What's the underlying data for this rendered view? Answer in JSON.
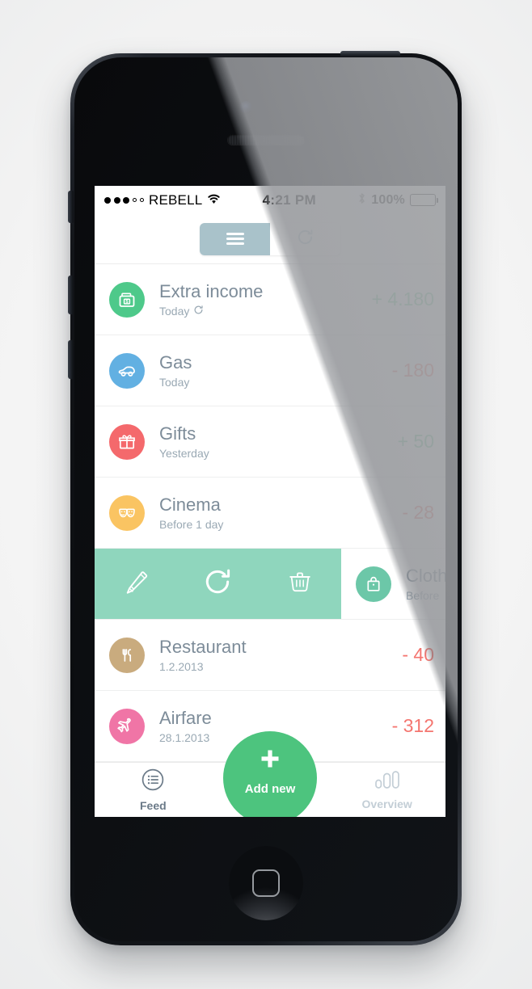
{
  "status_bar": {
    "signal_dots_filled": 3,
    "signal_dots_empty": 2,
    "carrier": "REBELL",
    "time": "4:21 PM",
    "battery_percent": "100%",
    "bluetooth_icon": "bluetooth-icon",
    "wifi_icon": "wifi-icon"
  },
  "header": {
    "segments": [
      {
        "id": "list",
        "icon": "hamburger-icon",
        "active": true
      },
      {
        "id": "repeat",
        "icon": "refresh-icon",
        "active": false
      }
    ]
  },
  "colors": {
    "positive": "#79d3a1",
    "negative": "#f4756f",
    "accent_green": "#4dc47e",
    "swipe_panel": "#8fd6bd",
    "segment_active": "#a9c2ca",
    "title_text": "#7d8c99",
    "sub_text": "#9aa9b4"
  },
  "transactions": [
    {
      "title": "Extra income",
      "subtitle": "Today",
      "recurring": true,
      "amount": "+ 4.180",
      "sign": "positive",
      "icon": "money-box-icon",
      "icon_color": "#4ec98a"
    },
    {
      "title": "Gas",
      "subtitle": "Today",
      "recurring": false,
      "amount": "- 180",
      "sign": "negative",
      "icon": "car-icon",
      "icon_color": "#62b0e2"
    },
    {
      "title": "Gifts",
      "subtitle": "Yesterday",
      "recurring": false,
      "amount": "+ 50",
      "sign": "positive",
      "icon": "gift-icon",
      "icon_color": "#f4696c"
    },
    {
      "title": "Cinema",
      "subtitle": "Before 1 day",
      "recurring": false,
      "amount": "- 28",
      "sign": "negative",
      "icon": "theater-masks-icon",
      "icon_color": "#fac462"
    },
    {
      "title": "Restaurant",
      "subtitle": "1.2.2013",
      "recurring": false,
      "amount": "- 40",
      "sign": "negative",
      "icon": "cutlery-icon",
      "icon_color": "#c9ab7e"
    },
    {
      "title": "Airfare",
      "subtitle": "28.1.2013",
      "recurring": false,
      "amount": "- 312",
      "sign": "negative",
      "icon": "airplane-icon",
      "icon_color": "#f075a6"
    }
  ],
  "swiped_row": {
    "title": "Cloth",
    "subtitle": "Before",
    "icon": "shopping-bag-icon",
    "icon_color": "#6cc7a8",
    "actions": [
      {
        "id": "edit",
        "icon": "pencil-icon"
      },
      {
        "id": "repeat",
        "icon": "refresh-icon"
      },
      {
        "id": "delete",
        "icon": "trash-icon"
      }
    ]
  },
  "tabbar": {
    "feed": {
      "label": "Feed",
      "icon": "feed-list-icon"
    },
    "add_new": {
      "label": "Add new",
      "icon": "plus-icon"
    },
    "overview": {
      "label": "Overview",
      "icon": "bar-chart-icon"
    }
  }
}
